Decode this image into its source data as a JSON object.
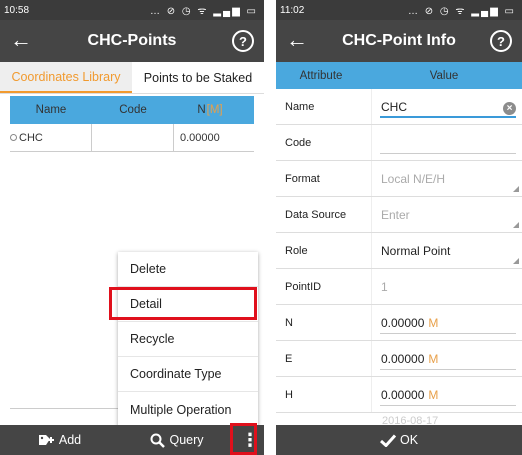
{
  "left": {
    "status_time": "10:58",
    "status_icons": "… ⊘ ◷ ᯤ ▂▄▆ ▭",
    "title": "CHC-Points",
    "help_glyph": "?",
    "tabs": [
      "Coordinates Library",
      "Points to be Staked"
    ],
    "columns": {
      "name": "Name",
      "code": "Code",
      "n": "N",
      "n_unit": "[M]"
    },
    "rows": [
      {
        "name": "CHC",
        "code": "",
        "n": "0.00000"
      }
    ],
    "menu": [
      "Delete",
      "Detail",
      "Recycle",
      "Coordinate Type",
      "Multiple Operation"
    ],
    "bottom": {
      "add": "Add",
      "query": "Query",
      "more": "⋮"
    }
  },
  "right": {
    "status_time": "11:02",
    "status_icons": "… ⊘ ◷ ᯤ ▂▄▆ ▭",
    "title": "CHC-Point Info",
    "help_glyph": "?",
    "headers": {
      "attribute": "Attribute",
      "value": "Value"
    },
    "fields": {
      "name": {
        "label": "Name",
        "value": "CHC"
      },
      "code": {
        "label": "Code",
        "value": ""
      },
      "format": {
        "label": "Format",
        "value": "Local N/E/H"
      },
      "data_source": {
        "label": "Data Source",
        "value": "Enter"
      },
      "role": {
        "label": "Role",
        "value": "Normal Point"
      },
      "pointid": {
        "label": "PointID",
        "value": "1"
      },
      "n": {
        "label": "N",
        "value": "0.00000",
        "unit": "M"
      },
      "e": {
        "label": "E",
        "value": "0.00000",
        "unit": "M"
      },
      "h": {
        "label": "H",
        "value": "0.00000",
        "unit": "M"
      }
    },
    "peek_date": "2016-08-17",
    "ok": "OK"
  },
  "colors": {
    "bar": "#454545",
    "header_blue": "#4aa8de",
    "accent_orange": "#f19a2f",
    "highlight_red": "#e0101c",
    "unit_orange": "#e8a04a"
  }
}
